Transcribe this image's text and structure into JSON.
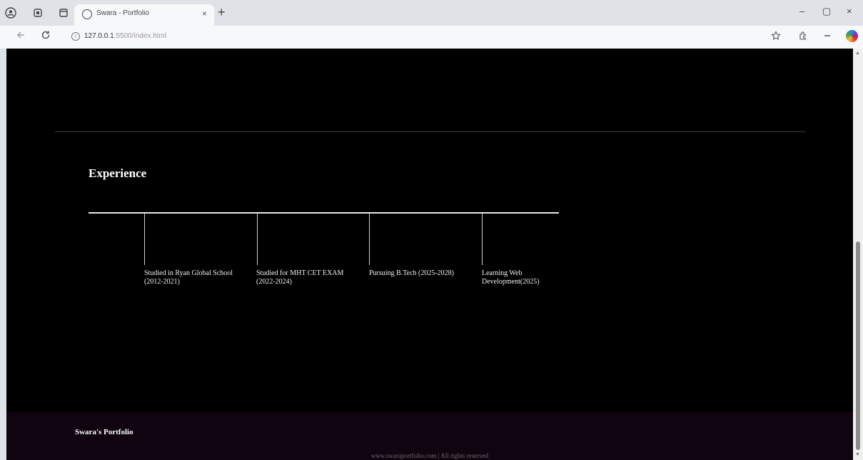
{
  "browser": {
    "tab_title": "Swara - Portfolio",
    "tab_close": "×",
    "new_tab": "+",
    "url_host": "127.0.0.1",
    "url_rest": ":5500/index.html",
    "window_controls": {
      "minimize": "–",
      "restore": "▢",
      "close": "×"
    }
  },
  "page": {
    "experience_title": "Experience",
    "timeline": [
      {
        "label": "Studied in Ryan Global School (2012-2021)"
      },
      {
        "label": "Studied for MHT CET EXAM (2022-2024)"
      },
      {
        "label": "Pursuing B.Tech (2025-2028)"
      },
      {
        "label": "Learning Web Development(2025)"
      }
    ],
    "footer": {
      "brand": "Swara's Portfolio",
      "copyright": "www.swaraportfolio.com | All rights reserved"
    }
  },
  "icons": {
    "profile": "profile-icon",
    "workspaces": "workspaces-icon",
    "tab_actions": "tab-actions-icon",
    "favicon": "globe-icon",
    "back": "back-arrow-icon",
    "reload": "reload-icon",
    "site_info": "info-icon",
    "favorite": "star-icon",
    "extensions": "extensions-icon",
    "more": "more-icon",
    "copilot": "copilot-icon"
  },
  "colors": {
    "page_background": "#000000",
    "footer_background": "#0f040f",
    "text": "#ffffff"
  }
}
